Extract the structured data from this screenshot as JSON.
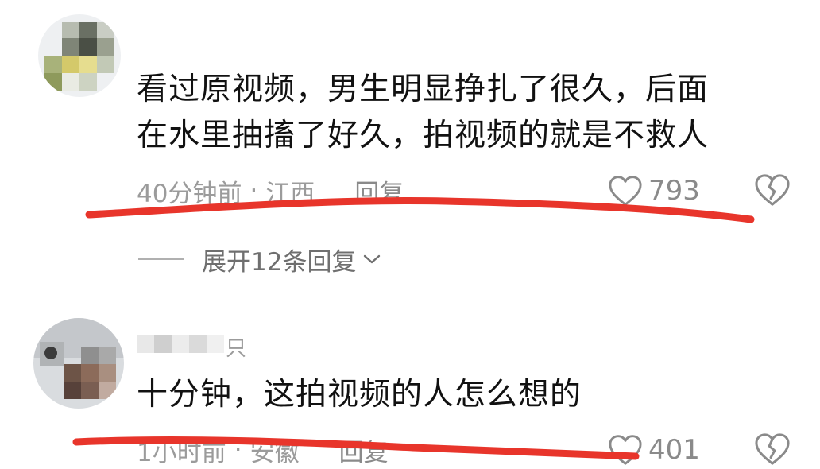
{
  "comments": [
    {
      "text_lines": [
        "看过原视频，男生明显挣扎了很久，后面",
        "在水里抽搐了好久，拍视频的就是不救人"
      ],
      "time": "40分钟前",
      "location": "江西",
      "reply_label": "回复",
      "likes": "793",
      "expand_replies": "展开12条回复"
    },
    {
      "username_fragment": "只",
      "text_lines": [
        "十分钟，这拍视频的人怎么想的"
      ],
      "time": "1小时前",
      "location": "安徽",
      "reply_label": "回复",
      "likes": "401"
    }
  ],
  "meta_separator": "·",
  "icons": {
    "like": "heart-outline-icon",
    "dislike": "broken-heart-icon",
    "expand": "chevron-down-icon"
  },
  "colors": {
    "annotation_underline": "#e8352b",
    "meta_text": "#9b9b9b",
    "comment_text": "#111111"
  }
}
